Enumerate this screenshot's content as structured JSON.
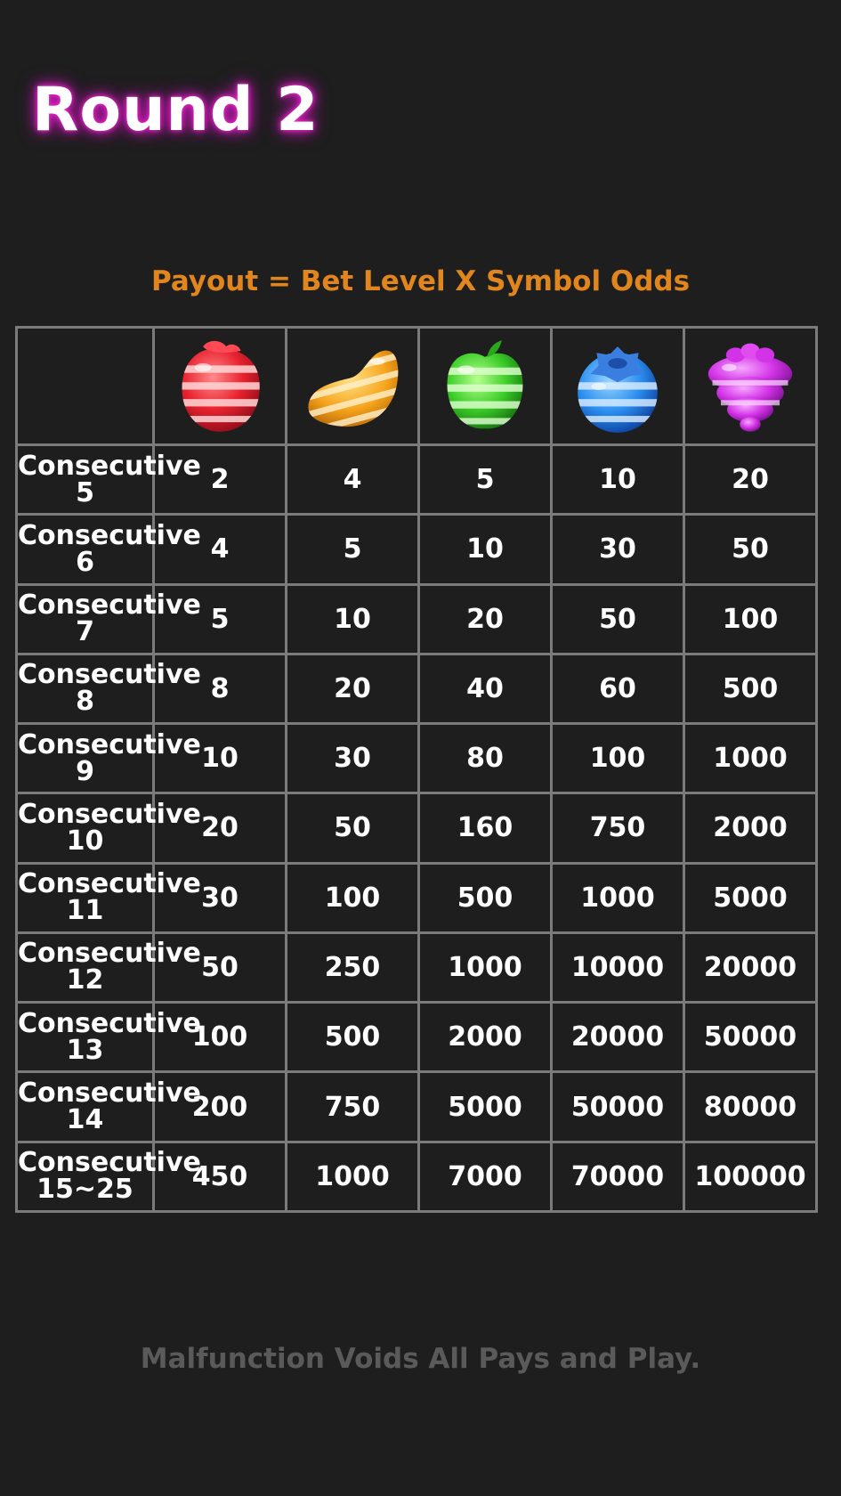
{
  "title": "Round 2",
  "formula": "Payout = Bet Level X Symbol Odds",
  "footer": "Malfunction Voids All Pays and Play.",
  "symbols": [
    {
      "icon": "strawberry-icon",
      "color": "#e8222f"
    },
    {
      "icon": "orange-slice-icon",
      "color": "#f7a51d"
    },
    {
      "icon": "apple-icon",
      "color": "#3ecf2a"
    },
    {
      "icon": "blueberry-icon",
      "color": "#2b8ff0"
    },
    {
      "icon": "grape-icon",
      "color": "#d233e6"
    }
  ],
  "rows": [
    {
      "label": "Consecutive",
      "count": "5",
      "values": [
        "2",
        "4",
        "5",
        "10",
        "20"
      ]
    },
    {
      "label": "Consecutive",
      "count": "6",
      "values": [
        "4",
        "5",
        "10",
        "30",
        "50"
      ]
    },
    {
      "label": "Consecutive",
      "count": "7",
      "values": [
        "5",
        "10",
        "20",
        "50",
        "100"
      ]
    },
    {
      "label": "Consecutive",
      "count": "8",
      "values": [
        "8",
        "20",
        "40",
        "60",
        "500"
      ]
    },
    {
      "label": "Consecutive",
      "count": "9",
      "values": [
        "10",
        "30",
        "80",
        "100",
        "1000"
      ]
    },
    {
      "label": "Consecutive",
      "count": "10",
      "values": [
        "20",
        "50",
        "160",
        "750",
        "2000"
      ]
    },
    {
      "label": "Consecutive",
      "count": "11",
      "values": [
        "30",
        "100",
        "500",
        "1000",
        "5000"
      ]
    },
    {
      "label": "Consecutive",
      "count": "12",
      "values": [
        "50",
        "250",
        "1000",
        "10000",
        "20000"
      ]
    },
    {
      "label": "Consecutive",
      "count": "13",
      "values": [
        "100",
        "500",
        "2000",
        "20000",
        "50000"
      ]
    },
    {
      "label": "Consecutive",
      "count": "14",
      "values": [
        "200",
        "750",
        "5000",
        "50000",
        "80000"
      ]
    },
    {
      "label": "Consecutive",
      "count": "15~25",
      "values": [
        "450",
        "1000",
        "7000",
        "70000",
        "100000"
      ]
    }
  ]
}
